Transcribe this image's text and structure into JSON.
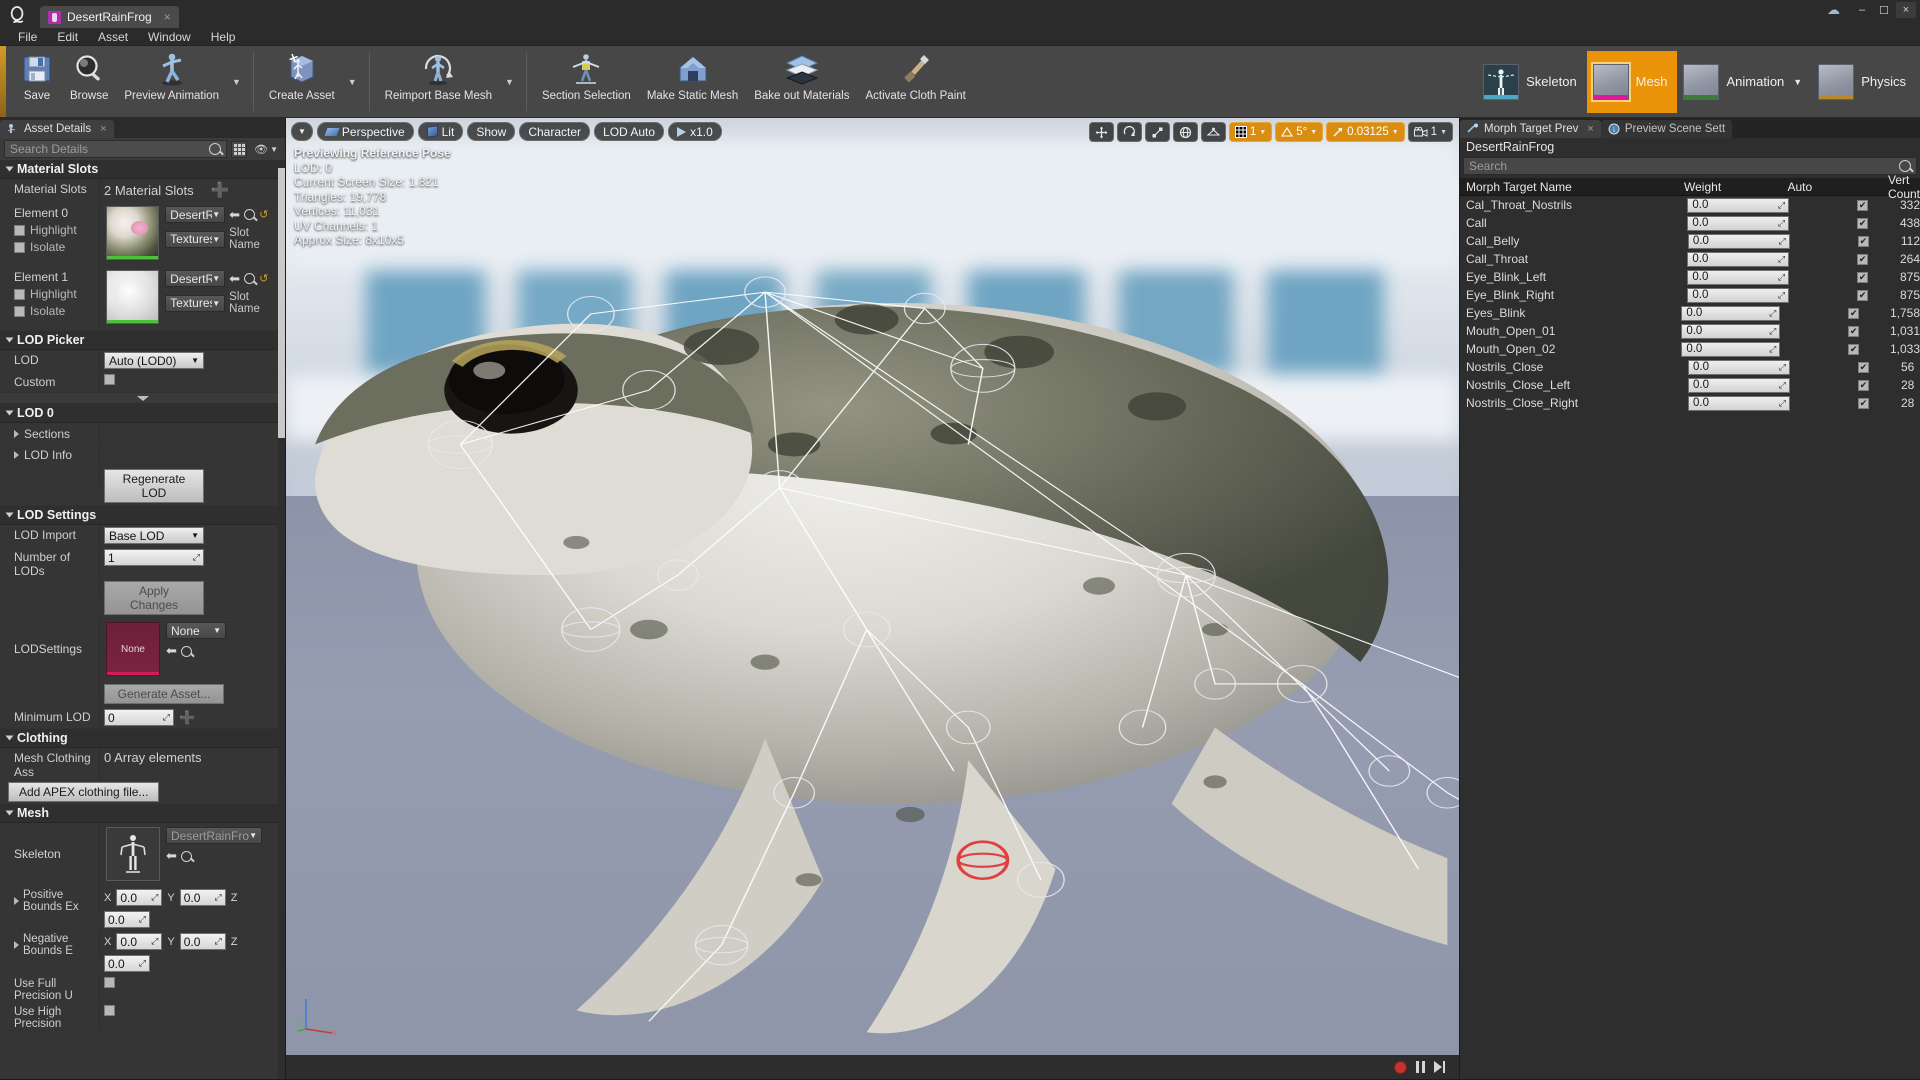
{
  "window": {
    "app_tab_title": "DesertRainFrog",
    "tab_close": "×",
    "minimize": "–",
    "maximize": "☐",
    "close": "×",
    "cloud_icon": "cloud-icon"
  },
  "menu": {
    "items": [
      "File",
      "Edit",
      "Asset",
      "Window",
      "Help"
    ]
  },
  "toolbar": {
    "buttons": [
      {
        "label": "Save",
        "icon": "save-icon"
      },
      {
        "label": "Browse",
        "icon": "browse-icon"
      },
      {
        "label": "Preview Animation",
        "icon": "preview-animation-icon",
        "dropdown": true
      },
      {
        "label": "Create Asset",
        "icon": "create-asset-icon",
        "dropdown": true
      },
      {
        "label": "Reimport Base Mesh",
        "icon": "reimport-icon",
        "dropdown": true
      },
      {
        "label": "Section Selection",
        "icon": "section-selection-icon"
      },
      {
        "label": "Make Static Mesh",
        "icon": "make-static-mesh-icon"
      },
      {
        "label": "Bake out Materials",
        "icon": "bake-materials-icon"
      },
      {
        "label": "Activate Cloth Paint",
        "icon": "cloth-paint-icon"
      }
    ],
    "modes": [
      {
        "label": "Skeleton",
        "active": false,
        "accent": "#4ca6c4",
        "dropdown": false
      },
      {
        "label": "Mesh",
        "active": true,
        "accent": "#e1189b",
        "dropdown": false
      },
      {
        "label": "Animation",
        "active": false,
        "accent": "#3e7a3a",
        "dropdown": true
      },
      {
        "label": "Physics",
        "active": false,
        "accent": "#b8892a",
        "dropdown": false
      }
    ]
  },
  "left_panel": {
    "tab_title": "Asset Details",
    "tab_close": "×",
    "search_placeholder": "Search Details",
    "sections": {
      "material_slots": {
        "title": "Material Slots",
        "row_label": "Material Slots",
        "count_text": "2 Material Slots",
        "add_icon": "plus-icon",
        "elements": [
          {
            "name": "Element 0",
            "highlight_label": "Highlight",
            "isolate_label": "Isolate",
            "material_name": "DesertRa",
            "textures_label": "Textures",
            "slot_name_label": "Slot Name",
            "thumb": "material-sphere-mossy"
          },
          {
            "name": "Element 1",
            "highlight_label": "Highlight",
            "isolate_label": "Isolate",
            "material_name": "DesertRa",
            "textures_label": "Textures",
            "slot_name_label": "Slot Name",
            "thumb": "material-sphere-white"
          }
        ]
      },
      "lod_picker": {
        "title": "LOD Picker",
        "lod_label": "LOD",
        "lod_value": "Auto (LOD0)",
        "custom_label": "Custom",
        "custom_checked": false
      },
      "lod0": {
        "title": "LOD 0",
        "sections_label": "Sections",
        "lod_info_label": "LOD Info",
        "regenerate_label": "Regenerate LOD"
      },
      "lod_settings": {
        "title": "LOD Settings",
        "lod_import_label": "LOD Import",
        "lod_import_value": "Base LOD",
        "number_of_lods_label": "Number of LODs",
        "number_of_lods_value": "1",
        "apply_changes_label": "Apply Changes",
        "lodsettings_label": "LODSettings",
        "lodsettings_thumb_text": "None",
        "lodsettings_value": "None",
        "generate_asset_label": "Generate Asset...",
        "minimum_lod_label": "Minimum LOD",
        "minimum_lod_value": "0",
        "minimum_lod_add_icon": "plus-icon"
      },
      "clothing": {
        "title": "Clothing",
        "mesh_clothing_label": "Mesh Clothing Ass",
        "mesh_clothing_value": "0 Array elements",
        "add_apex_label": "Add APEX clothing file..."
      },
      "mesh": {
        "title": "Mesh",
        "skeleton_label": "Skeleton",
        "skeleton_value": "DesertRainFrog_Skele",
        "skeleton_thumb": "skeleton-icon",
        "positive_bounds_label": "Positive Bounds Ex",
        "negative_bounds_label": "Negative Bounds E",
        "axes": [
          "X",
          "Y",
          "Z"
        ],
        "positive_bounds_values": [
          "0.0",
          "0.0",
          "0.0"
        ],
        "negative_bounds_values": [
          "0.0",
          "0.0",
          "0.0"
        ],
        "use_full_precision_label": "Use Full Precision U",
        "use_full_precision_checked": false,
        "use_high_precision_label": "Use High Precision",
        "use_high_precision_checked": false
      }
    }
  },
  "viewport": {
    "menu_arrow_icon": "chevron-down-icon",
    "view_mode": "Perspective",
    "lit_mode": "Lit",
    "show_label": "Show",
    "character_label": "Character",
    "lod_label": "LOD Auto",
    "playrate_label": "x1.0",
    "right_tools": [
      {
        "name": "transform-select",
        "label": "",
        "icon": "move-select-icon",
        "active": false
      },
      {
        "name": "rotate-tool",
        "label": "",
        "icon": "rotate-icon",
        "active": false
      },
      {
        "name": "scale-tool",
        "label": "",
        "icon": "scale-icon",
        "active": false
      },
      {
        "name": "coordinate-space",
        "label": "",
        "icon": "globe-icon",
        "active": false
      },
      {
        "name": "surface-snap",
        "label": "",
        "icon": "surface-snap-icon",
        "active": false
      },
      {
        "name": "grid-snap",
        "label": "1",
        "icon": "grid-icon",
        "active": true
      },
      {
        "name": "angle-snap",
        "label": "5°",
        "icon": "angle-icon",
        "active": true
      },
      {
        "name": "scale-snap",
        "label": "0.03125",
        "icon": "scale-snap-icon",
        "active": true
      },
      {
        "name": "camera-speed",
        "label": "1",
        "icon": "camera-icon",
        "active": false
      }
    ],
    "stats": [
      "Previewing Reference Pose",
      "LOD: 0",
      "Current Screen Size: 1.821",
      "Triangles: 19,778",
      "Vertices: 11,031",
      "UV Channels: 1",
      "Approx Size: 8x10x5"
    ],
    "transport": [
      {
        "name": "record-button",
        "icon": "record-icon"
      },
      {
        "name": "pause-button",
        "icon": "pause-icon"
      },
      {
        "name": "step-forward-button",
        "icon": "step-forward-icon"
      }
    ],
    "gizmo_axes": [
      "z",
      "y",
      "x"
    ]
  },
  "right_panel": {
    "tabs": [
      {
        "label": "Morph Target Prev",
        "active": true,
        "icon": "morph-target-icon",
        "close": "×"
      },
      {
        "label": "Preview Scene Sett",
        "active": false,
        "icon": "info-icon"
      }
    ],
    "asset_name": "DesertRainFrog",
    "search_placeholder": "Search",
    "search_icon": "search-icon",
    "columns": [
      "Morph Target Name",
      "Weight",
      "Auto",
      "Vert Count"
    ],
    "rows": [
      {
        "name": "Cal_Throat_Nostrils",
        "weight": "0.0",
        "auto": true,
        "vert_count": "332"
      },
      {
        "name": "Call",
        "weight": "0.0",
        "auto": true,
        "vert_count": "438"
      },
      {
        "name": "Call_Belly",
        "weight": "0.0",
        "auto": true,
        "vert_count": "112"
      },
      {
        "name": "Call_Throat",
        "weight": "0.0",
        "auto": true,
        "vert_count": "264"
      },
      {
        "name": "Eye_Blink_Left",
        "weight": "0.0",
        "auto": true,
        "vert_count": "875"
      },
      {
        "name": "Eye_Blink_Right",
        "weight": "0.0",
        "auto": true,
        "vert_count": "875"
      },
      {
        "name": "Eyes_Blink",
        "weight": "0.0",
        "auto": true,
        "vert_count": "1,758"
      },
      {
        "name": "Mouth_Open_01",
        "weight": "0.0",
        "auto": true,
        "vert_count": "1,031"
      },
      {
        "name": "Mouth_Open_02",
        "weight": "0.0",
        "auto": true,
        "vert_count": "1,033"
      },
      {
        "name": "Nostrils_Close",
        "weight": "0.0",
        "auto": true,
        "vert_count": "56"
      },
      {
        "name": "Nostrils_Close_Left",
        "weight": "0.0",
        "auto": true,
        "vert_count": "28"
      },
      {
        "name": "Nostrils_Close_Right",
        "weight": "0.0",
        "auto": true,
        "vert_count": "28"
      }
    ]
  },
  "colors": {
    "accent_orange": "#eb9309",
    "panel_bg": "#353535",
    "toolbar_bg": "#474747",
    "dark_bg": "#2b2b2b"
  }
}
